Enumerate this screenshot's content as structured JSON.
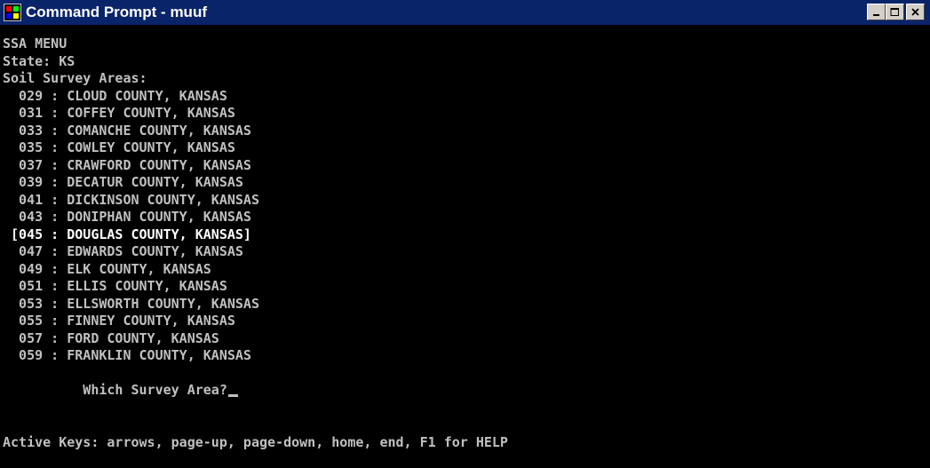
{
  "window": {
    "title": "Command Prompt - muuf",
    "icon": "ms-dos-icon",
    "buttons": [
      "minimize",
      "maximize",
      "close"
    ],
    "colors": {
      "titlebar": "#0a246a",
      "console_bg": "#000000",
      "console_text": "#c0c0c0",
      "highlight_text": "#ffffff"
    }
  },
  "console": {
    "menu_title": "SSA MENU",
    "state_line": "State: KS",
    "areas_heading": "Soil Survey Areas:",
    "areas": [
      {
        "text": "  029 : CLOUD COUNTY, KANSAS",
        "selected": false
      },
      {
        "text": "  031 : COFFEY COUNTY, KANSAS",
        "selected": false
      },
      {
        "text": "  033 : COMANCHE COUNTY, KANSAS",
        "selected": false
      },
      {
        "text": "  035 : COWLEY COUNTY, KANSAS",
        "selected": false
      },
      {
        "text": "  037 : CRAWFORD COUNTY, KANSAS",
        "selected": false
      },
      {
        "text": "  039 : DECATUR COUNTY, KANSAS",
        "selected": false
      },
      {
        "text": "  041 : DICKINSON COUNTY, KANSAS",
        "selected": false
      },
      {
        "text": "  043 : DONIPHAN COUNTY, KANSAS",
        "selected": false
      },
      {
        "text": " [045 : DOUGLAS COUNTY, KANSAS]",
        "selected": true
      },
      {
        "text": "  047 : EDWARDS COUNTY, KANSAS",
        "selected": false
      },
      {
        "text": "  049 : ELK COUNTY, KANSAS",
        "selected": false
      },
      {
        "text": "  051 : ELLIS COUNTY, KANSAS",
        "selected": false
      },
      {
        "text": "  053 : ELLSWORTH COUNTY, KANSAS",
        "selected": false
      },
      {
        "text": "  055 : FINNEY COUNTY, KANSAS",
        "selected": false
      },
      {
        "text": "  057 : FORD COUNTY, KANSAS",
        "selected": false
      },
      {
        "text": "  059 : FRANKLIN COUNTY, KANSAS",
        "selected": false
      }
    ],
    "prompt": "          Which Survey Area?",
    "active_keys": "Active Keys: arrows, page-up, page-down, home, end, F1 for HELP"
  }
}
